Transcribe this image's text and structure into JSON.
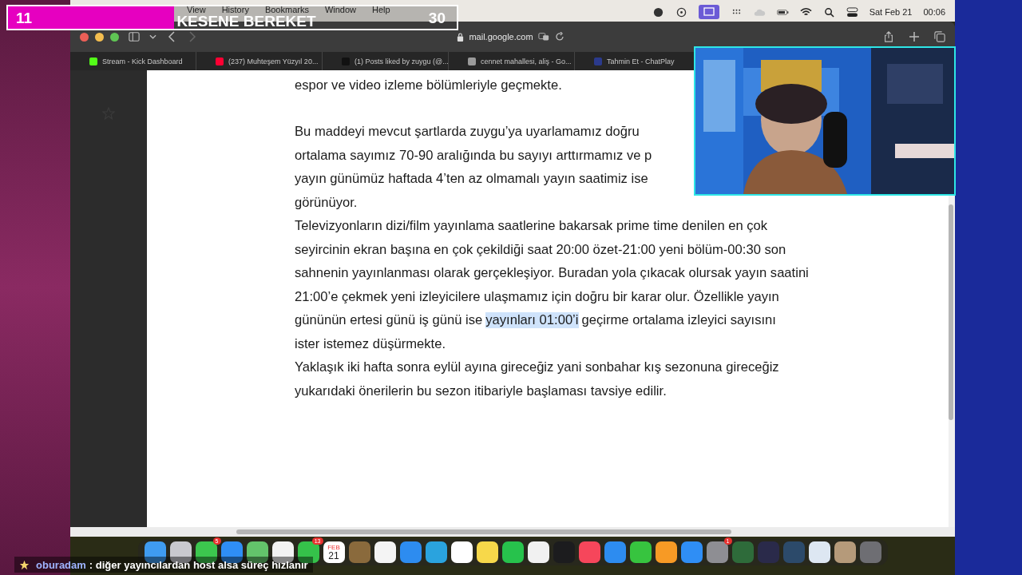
{
  "goal_bar": {
    "current": "11",
    "title": "KESENE BEREKET",
    "target": "30",
    "level": 0.37
  },
  "menu_bar": {
    "items": [
      "View",
      "History",
      "Bookmarks",
      "Window",
      "Help"
    ],
    "date": "Sat Feb 21",
    "time": "00:06"
  },
  "browser": {
    "address": "mail.google.com",
    "tabs": [
      {
        "title": "Stream - Kick Dashboard",
        "selected": false,
        "color": "#53fc18"
      },
      {
        "title": "(237) Muhteşem Yüzyıl 20...",
        "selected": false,
        "color": "#ff0033"
      },
      {
        "title": "(1) Posts liked by zuygu (@...",
        "selected": false,
        "color": "#111111"
      },
      {
        "title": "cennet mahallesi, aliş - Go...",
        "selected": false,
        "color": "#9a9a9a"
      },
      {
        "title": "Tahmin Et - ChatPlay",
        "selected": false,
        "color": "#2b3a8c"
      }
    ]
  },
  "document": {
    "paragraphs": [
      {
        "lines": [
          {
            "text": "espor ve video izleme bölümleriyle geçmekte."
          }
        ]
      },
      {
        "lines": [
          {
            "text": "Bu maddeyi mevcut şartlarda zuygu’ya uyarlamamız doğru"
          },
          {
            "text": "ortalama sayımız 70-90 aralığında bu sayıyı arttırmamız ve p"
          },
          {
            "text": "yayın günümüz haftada 4’ten az olmamalı yayın saatimiz ise"
          },
          {
            "text": "görünüyor."
          }
        ]
      },
      {
        "lines": [
          {
            "text": "Televizyonların dizi/film yayınlama saatlerine bakarsak prime time denilen en çok"
          },
          {
            "text": "seyircinin ekran başına en çok çekildiği saat 20:00 özet-21:00 yeni bölüm-00:30 son"
          },
          {
            "text": "sahnenin yayınlanması olarak gerçekleşiyor. Buradan yola çıkacak olursak yayın saatini"
          },
          {
            "text": "21:00’e çekmek yeni izleyicilere ulaşmamız için doğru bir karar olur. Özellikle yayın"
          },
          {
            "text": "gününün ertesi günü iş günü ise",
            "selected_text": "yayınları 01:00’i",
            "after": "geçirme ortalama izleyici sayısını"
          },
          {
            "text": "ister istemez düşürmekte."
          }
        ]
      },
      {
        "lines": [
          {
            "text": "Yaklaşık iki hafta sonra eylül ayına gireceğiz yani sonbahar kış sezonuna gireceğiz"
          },
          {
            "text": "yukarıdaki önerilerin bu sezon itibariyle başlaması tavsiye edilir."
          }
        ]
      }
    ]
  },
  "dock": {
    "items": [
      {
        "color": "#3f9bf0"
      },
      {
        "color": "#c9c9cf"
      },
      {
        "color": "#3cc74e",
        "badge": "5"
      },
      {
        "color": "#2f8ef5"
      },
      {
        "color": "#63c36b"
      },
      {
        "color": "#f2f2f2"
      },
      {
        "color": "#35c24a",
        "badge": "13"
      },
      {
        "color": "#ffffff",
        "month": "FEB",
        "day": "21"
      },
      {
        "color": "#8a6a3c"
      },
      {
        "color": "#f4f4f4"
      },
      {
        "color": "#2d8cf0"
      },
      {
        "color": "#2aa3de"
      },
      {
        "color": "#ffffff"
      },
      {
        "color": "#f7d84a"
      },
      {
        "color": "#27c24c"
      },
      {
        "color": "#f1f1f1"
      },
      {
        "color": "#1c1c1e"
      },
      {
        "color": "#f6465b"
      },
      {
        "color": "#2d8cf0"
      },
      {
        "color": "#37c43f"
      },
      {
        "color": "#f79a25"
      },
      {
        "color": "#2f8ef5"
      },
      {
        "color": "#8e8e93",
        "badge": "1"
      },
      {
        "color": "#2e6b3a"
      },
      {
        "color": "#2a2a4a"
      },
      {
        "color": "#2c4a6a"
      },
      {
        "color": "#dde7f2"
      },
      {
        "color": "#b59a7a"
      },
      {
        "color": "#6e6e73"
      }
    ]
  },
  "chat": {
    "user": "oburadam",
    "message": ": diğer yayıncılardan host alsa süreç hızlanır"
  }
}
